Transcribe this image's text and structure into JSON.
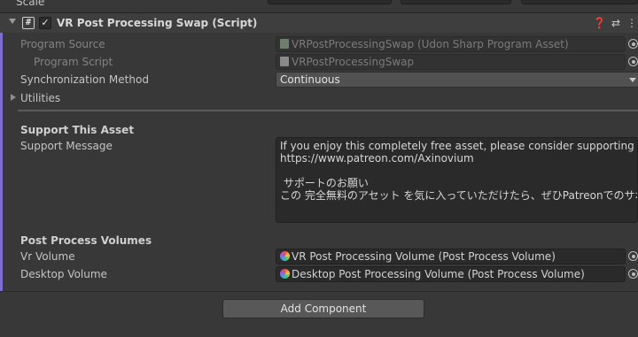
{
  "top_strip": {
    "label": "Scale"
  },
  "component": {
    "title": "VR Post Processing Swap (Script)",
    "enabled": true,
    "header_icons": [
      "help-icon",
      "presets-icon",
      "more-icon"
    ]
  },
  "fields": {
    "program_source": {
      "label": "Program Source",
      "value": "VRPostProcessingSwap (Udon Sharp Program Asset)"
    },
    "program_script": {
      "label": "Program Script",
      "value": "VRPostProcessingSwap"
    },
    "sync_method": {
      "label": "Synchronization Method",
      "value": "Continuous"
    },
    "utilities": {
      "label": "Utilities"
    }
  },
  "support": {
    "heading": "Support This Asset",
    "message_label": "Support Message",
    "message_lines": [
      "If you enjoy this completely free asset, please consider supporting my wo",
      "https://www.patreon.com/Axinovium",
      "",
      " サポートのお願い",
      "この 完全無料のアセット を気に入っていただけたら、ぜひPatreonでのサポ"
    ]
  },
  "volumes": {
    "heading": "Post Process Volumes",
    "vr": {
      "label": "Vr Volume",
      "value": "VR Post Processing Volume (Post Process Volume)"
    },
    "desktop": {
      "label": "Desktop Volume",
      "value": "Desktop Post Processing Volume (Post Process Volume)"
    }
  },
  "add_component_label": "Add Component",
  "colors": {
    "accent": "#7f6cd1",
    "background": "#383838",
    "field": "#2a2a2a"
  }
}
